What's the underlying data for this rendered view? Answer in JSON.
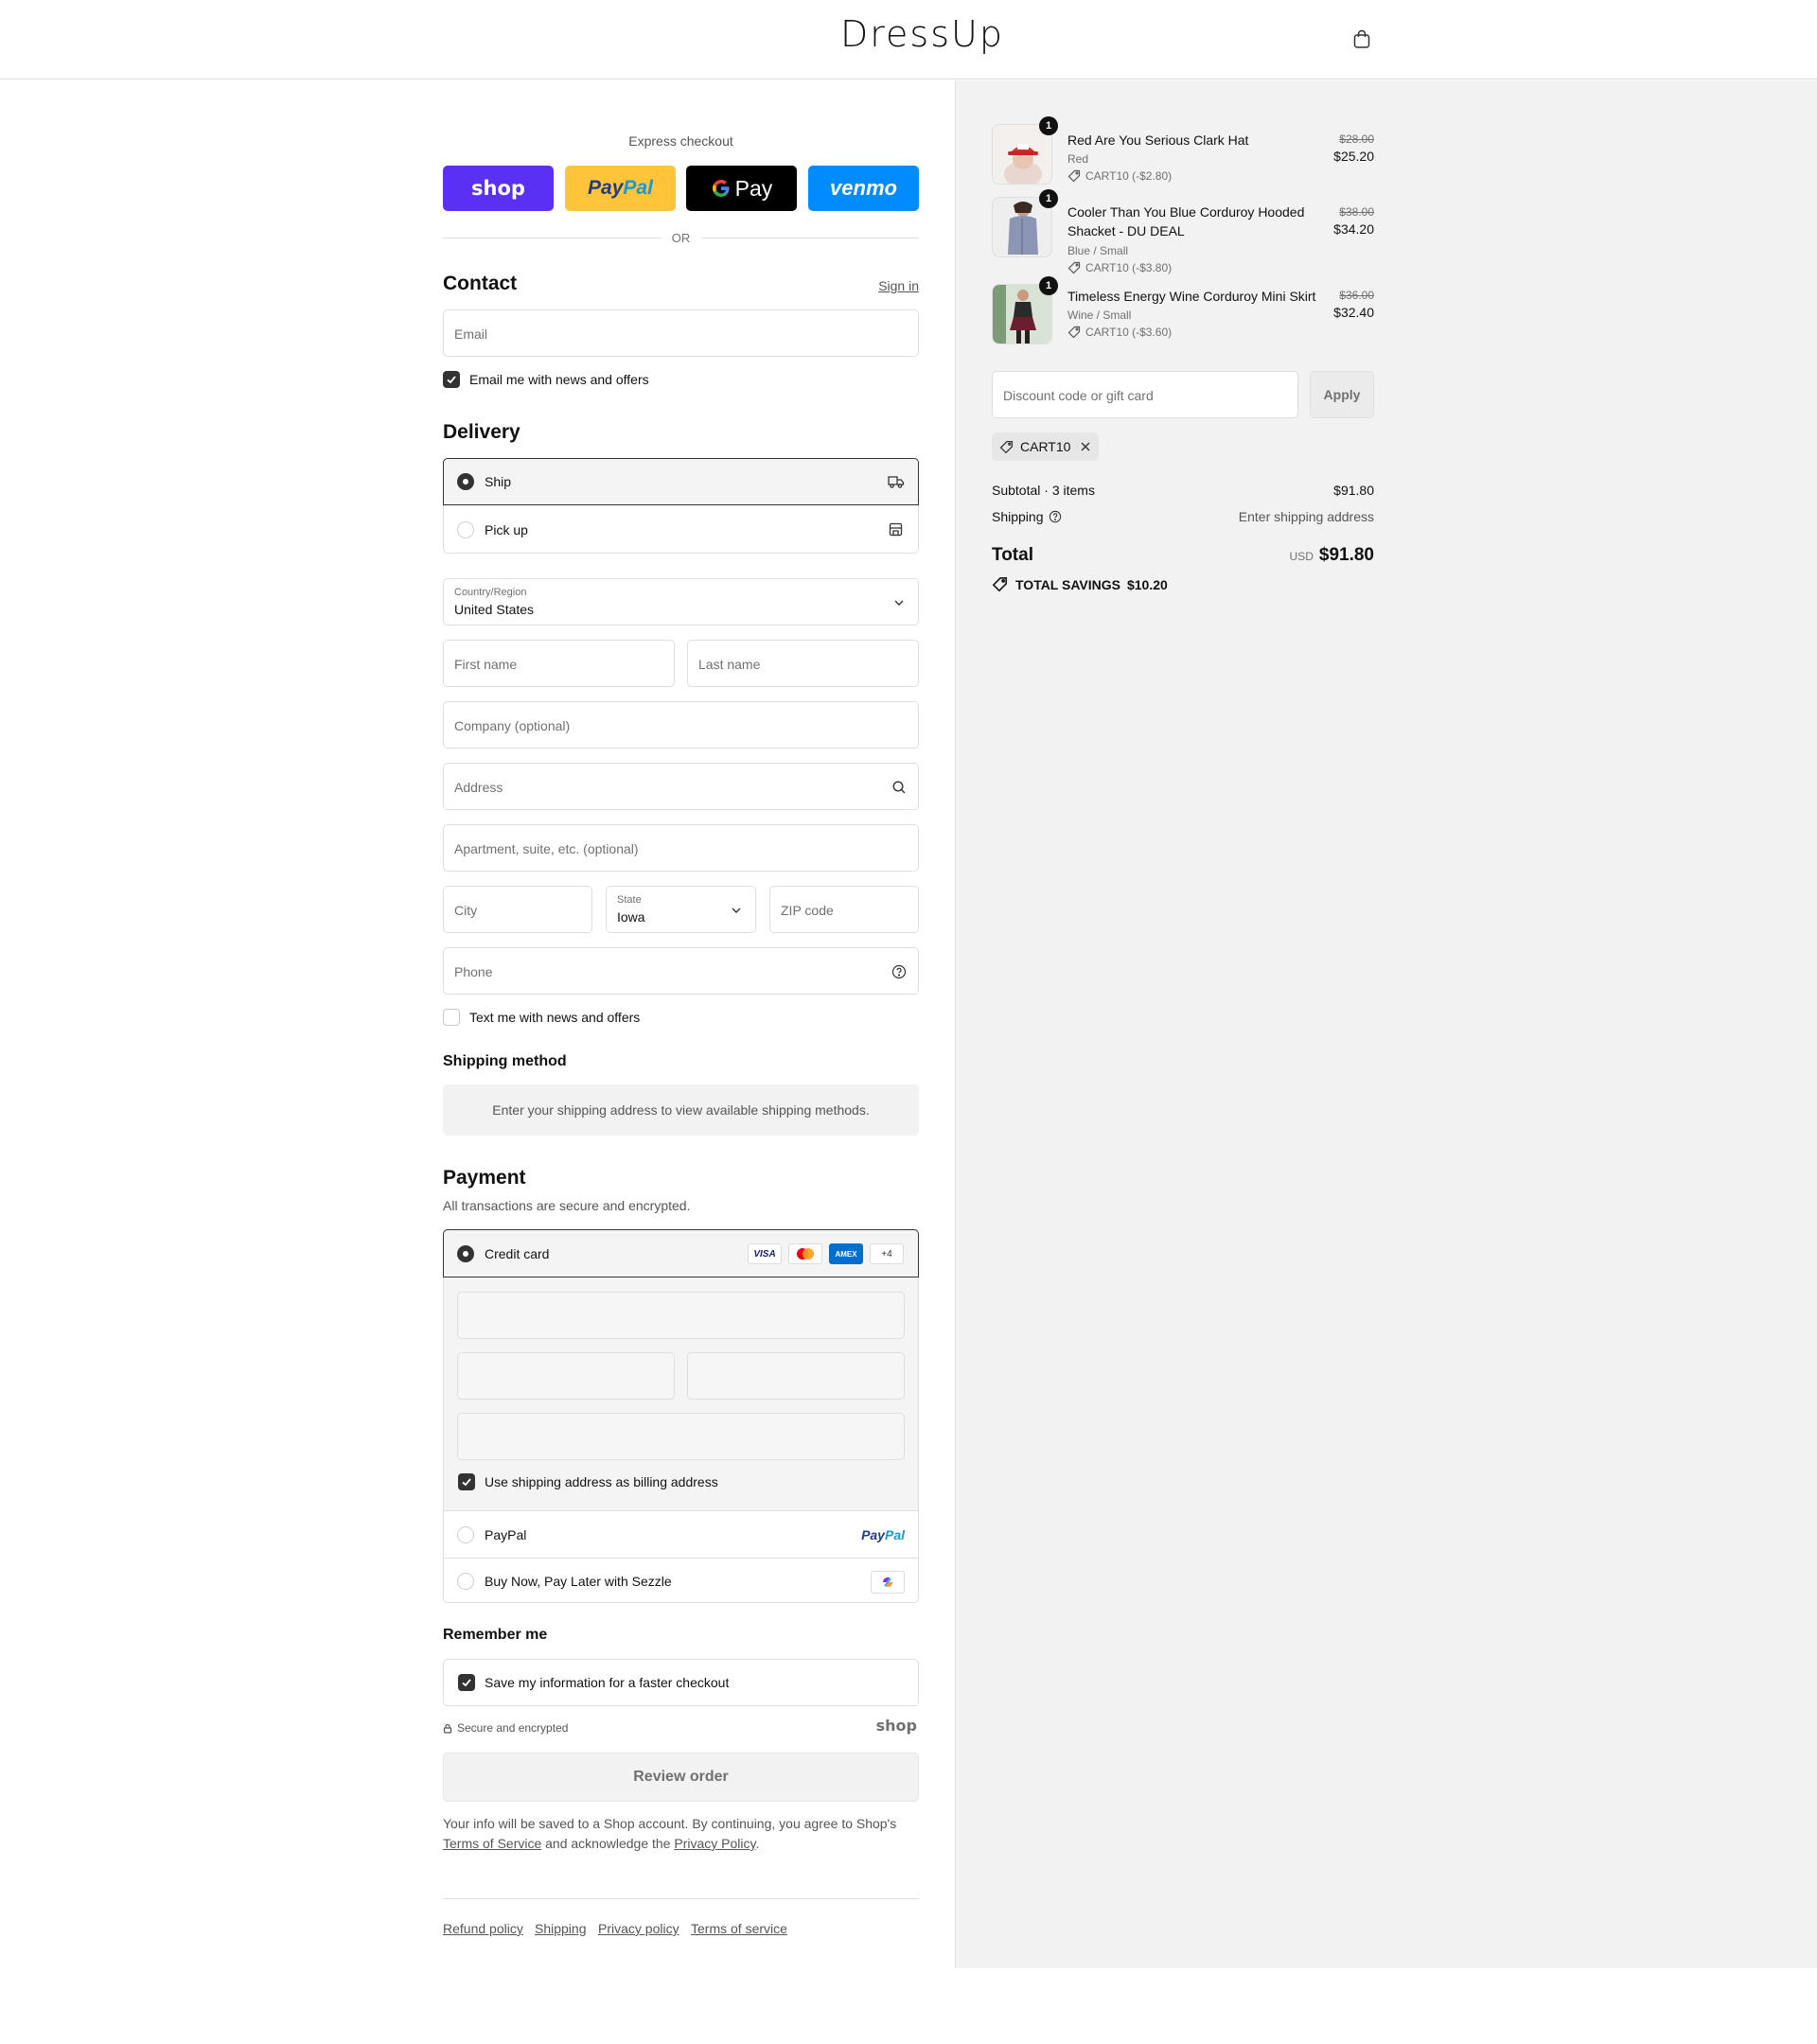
{
  "header": {
    "logo": "DressUp",
    "cart_icon": "shopping-bag-icon"
  },
  "express": {
    "title": "Express checkout",
    "shop_label": "shop",
    "paypal_label_1": "Pay",
    "paypal_label_2": "Pal",
    "gpay_label": "Pay",
    "venmo_label": "venmo",
    "or": "OR"
  },
  "contact": {
    "title": "Contact",
    "sign_in": "Sign in",
    "email_placeholder": "Email",
    "email_news": "Email me with news and offers"
  },
  "delivery": {
    "title": "Delivery",
    "ship": "Ship",
    "pickup": "Pick up",
    "country_label": "Country/Region",
    "country_value": "United States",
    "first_name": "First name",
    "last_name": "Last name",
    "company": "Company (optional)",
    "address": "Address",
    "apartment": "Apartment, suite, etc. (optional)",
    "city": "City",
    "state_label": "State",
    "state_value": "Iowa",
    "zip": "ZIP code",
    "phone": "Phone",
    "text_news": "Text me with news and offers"
  },
  "shipping_method": {
    "title": "Shipping method",
    "note": "Enter your shipping address to view available shipping methods."
  },
  "payment": {
    "title": "Payment",
    "subtitle": "All transactions are secure and encrypted.",
    "credit_card": "Credit card",
    "card_visa": "VISA",
    "card_amex": "AMEX",
    "card_more": "+4",
    "billing_same": "Use shipping address as billing address",
    "paypal": "PayPal",
    "paypal_logo_1": "Pay",
    "paypal_logo_2": "Pal",
    "sezzle": "Buy Now, Pay Later with Sezzle"
  },
  "remember": {
    "title": "Remember me",
    "save_info": "Save my information for a faster checkout",
    "secure": "Secure and encrypted",
    "shop_logo": "shop"
  },
  "review_button": "Review order",
  "legal": {
    "text_1": "Your info will be saved to a Shop account. By continuing, you agree to Shop's",
    "terms": "Terms of Service",
    "text_2": "and acknowledge the",
    "privacy": "Privacy Policy",
    "text_3": "."
  },
  "footer_links": [
    "Refund policy",
    "Shipping",
    "Privacy policy",
    "Terms of service"
  ],
  "cart": {
    "items": [
      {
        "qty": "1",
        "name": "Red Are You Serious Clark Hat",
        "variant": "Red",
        "discount": "CART10 (-$2.80)",
        "old_price": "$28.00",
        "price": "$25.20"
      },
      {
        "qty": "1",
        "name": "Cooler Than You Blue Corduroy Hooded Shacket - DU DEAL",
        "variant": "Blue / Small",
        "discount": "CART10 (-$3.80)",
        "old_price": "$38.00",
        "price": "$34.20"
      },
      {
        "qty": "1",
        "name": "Timeless Energy Wine Corduroy Mini Skirt",
        "variant": "Wine / Small",
        "discount": "CART10 (-$3.60)",
        "old_price": "$36.00",
        "price": "$32.40"
      }
    ],
    "discount_placeholder": "Discount code or gift card",
    "apply": "Apply",
    "applied_code": "CART10",
    "subtotal_label": "Subtotal · 3 items",
    "subtotal_value": "$91.80",
    "shipping_label": "Shipping",
    "shipping_value": "Enter shipping address",
    "total_label": "Total",
    "currency": "USD",
    "total_value": "$91.80",
    "savings_label": "TOTAL SAVINGS",
    "savings_value": "$10.20"
  },
  "colors": {
    "shop": "#5a31f4",
    "paypal": "#ffc439",
    "gpay": "#000000",
    "venmo": "#008cff",
    "summary_bg": "#f2f2f2"
  }
}
